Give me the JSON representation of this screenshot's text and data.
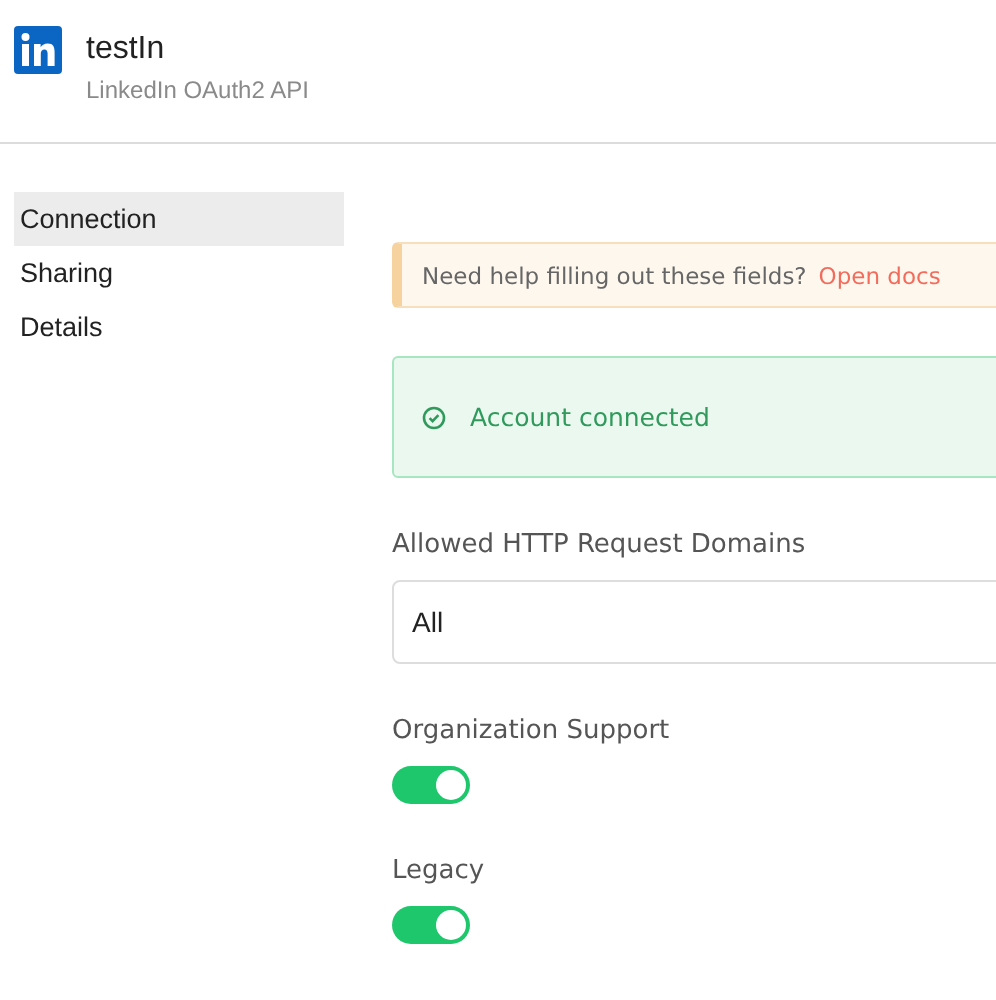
{
  "header": {
    "title": "testIn",
    "subtitle": "LinkedIn OAuth2 API"
  },
  "sidebar": {
    "items": [
      {
        "label": "Connection",
        "selected": true
      },
      {
        "label": "Sharing",
        "selected": false
      },
      {
        "label": "Details",
        "selected": false
      }
    ]
  },
  "notice": {
    "text": "Need help filling out these fields?",
    "link": "Open docs"
  },
  "status": {
    "text": "Account connected"
  },
  "fields": [
    {
      "kind": "select",
      "label": "Allowed HTTP Request Domains",
      "value": "All"
    },
    {
      "kind": "toggle",
      "label": "Organization Support",
      "on": true
    },
    {
      "kind": "toggle",
      "label": "Legacy",
      "on": true
    }
  ]
}
